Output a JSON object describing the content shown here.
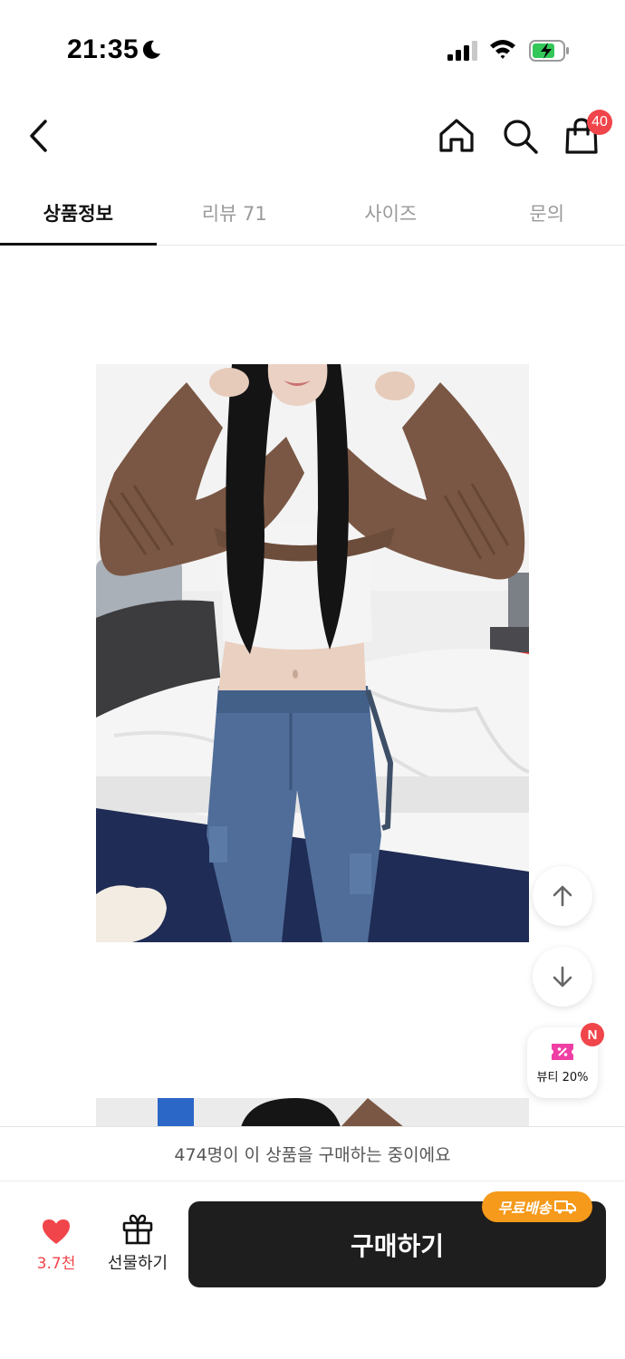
{
  "status_bar": {
    "time": "21:35"
  },
  "header": {
    "cart_count": "40"
  },
  "tabs": [
    {
      "label": "상품정보",
      "active": true
    },
    {
      "label": "리뷰 71",
      "active": false
    },
    {
      "label": "사이즈",
      "active": false
    },
    {
      "label": "문의",
      "active": false
    }
  ],
  "floating": {
    "beauty_label": "뷰티 20%",
    "new_badge": "N"
  },
  "banner": {
    "text": "474명이 이 상품을 구매하는 중이에요"
  },
  "bottom_bar": {
    "like_count": "3.7천",
    "gift_label": "선물하기",
    "buy_label": "구매하기",
    "free_shipping": "무료배송"
  },
  "colors": {
    "accent_red": "#f0454a",
    "buy_button": "#1e1e1e",
    "free_ship": "#f59a1b"
  }
}
